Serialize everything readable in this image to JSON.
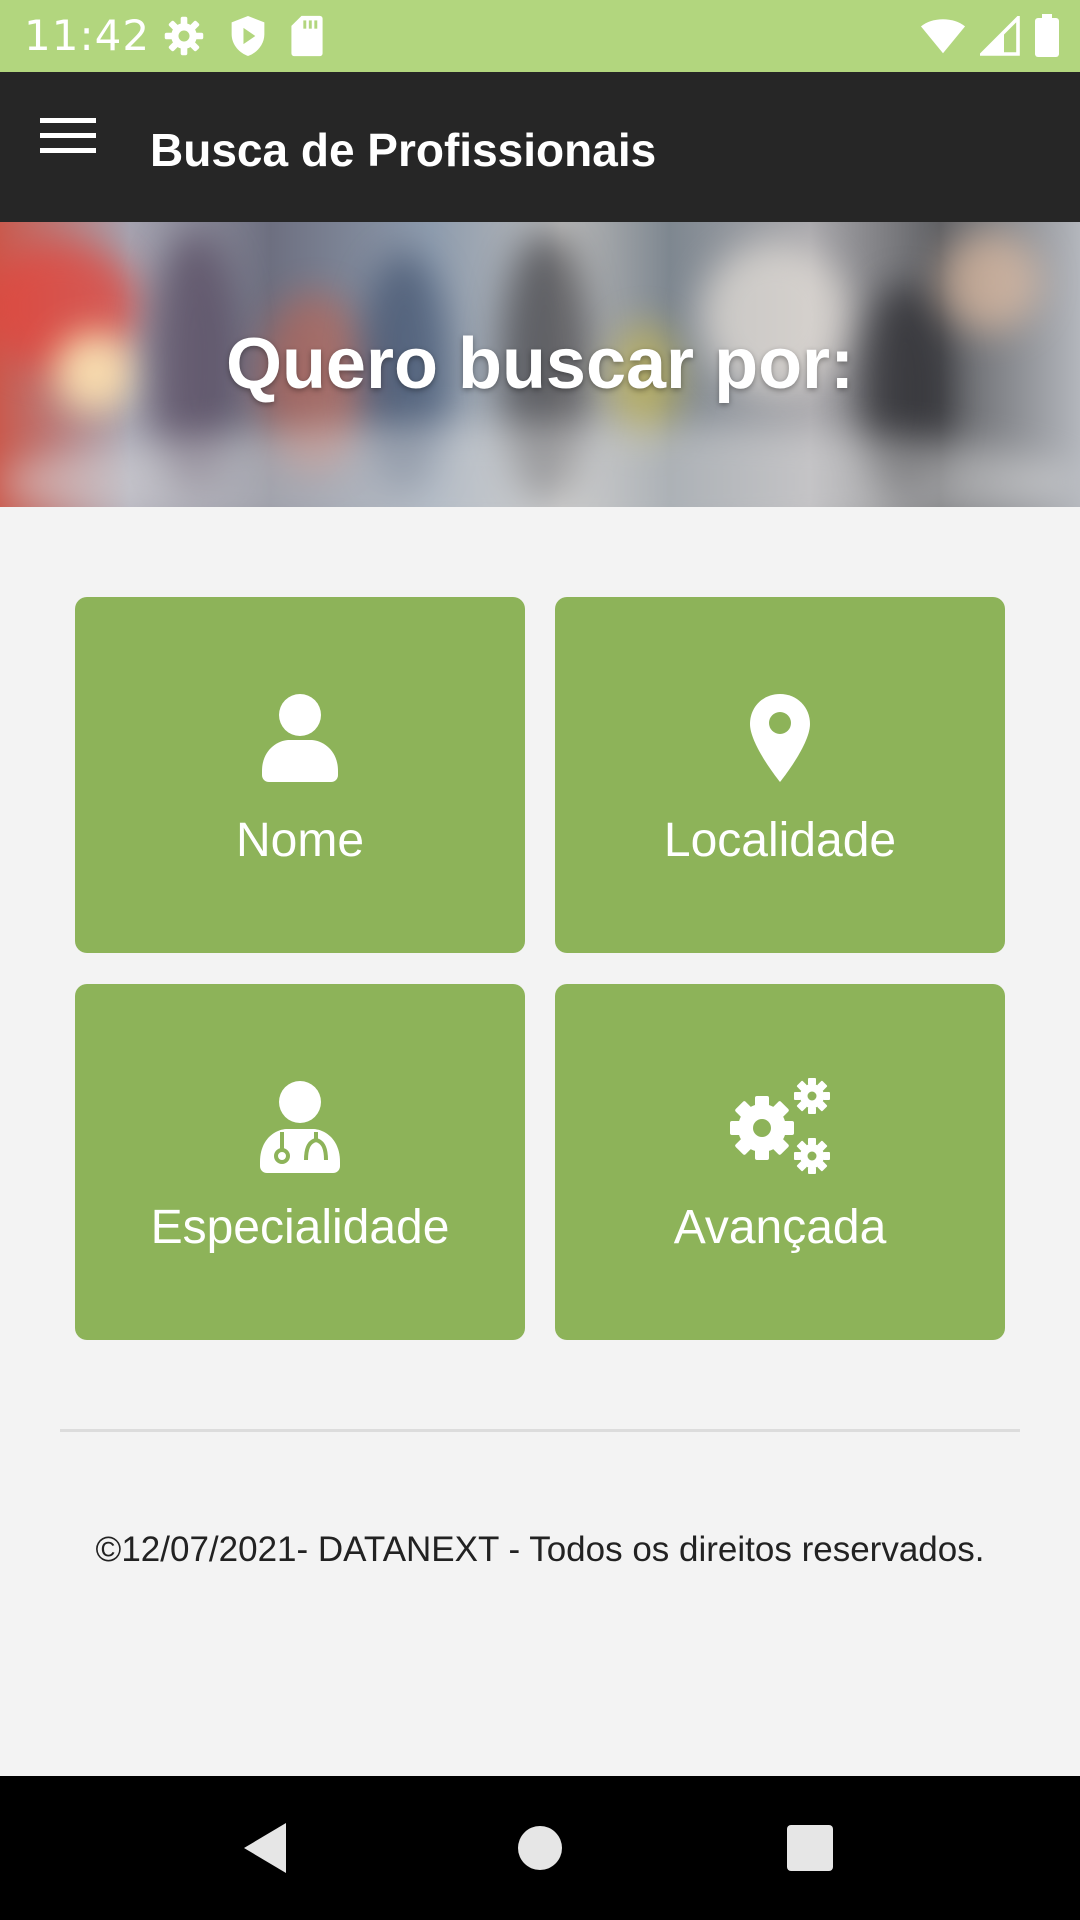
{
  "status_bar": {
    "time": "11:42",
    "left_icons": [
      "settings-icon",
      "shield-icon",
      "sd-card-icon"
    ],
    "right_icons": [
      "wifi-icon",
      "cell-signal-icon",
      "battery-icon"
    ]
  },
  "app_bar": {
    "menu_icon": "hamburger-menu-icon",
    "title": "Busca de Profissionais",
    "background": "#262626"
  },
  "hero": {
    "title": "Quero buscar por:"
  },
  "search_options": [
    {
      "label": "Nome",
      "icon": "person-icon"
    },
    {
      "label": "Localidade",
      "icon": "map-pin-icon"
    },
    {
      "label": "Especialidade",
      "icon": "doctor-icon"
    },
    {
      "label": "Avançada",
      "icon": "gears-icon"
    }
  ],
  "footer": {
    "text": "©12/07/2021- DATANEXT - Todos os direitos reservados."
  },
  "nav_bar": {
    "buttons": [
      "back-icon",
      "home-icon",
      "recents-icon"
    ]
  },
  "colors": {
    "status_bar": "#b2d67e",
    "tile": "#8db359",
    "page_background": "#f3f3f3"
  }
}
